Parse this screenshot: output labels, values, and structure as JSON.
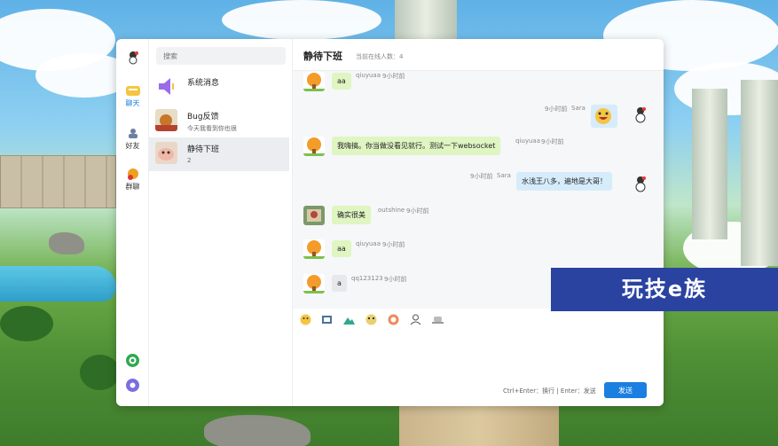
{
  "nav": {
    "items": [
      {
        "label": "聊天",
        "icon": "chat-icon"
      },
      {
        "label": "好友",
        "icon": "friends-icon"
      },
      {
        "label": "群聊",
        "icon": "group-icon"
      }
    ],
    "bottom_icons": [
      "help-icon",
      "settings-icon"
    ]
  },
  "search": {
    "placeholder": "搜索"
  },
  "conversations": [
    {
      "name": "系统消息",
      "preview": ""
    },
    {
      "name": "Bug反馈",
      "preview": "今天我看到你也很"
    },
    {
      "name": "静待下班",
      "preview": "2"
    }
  ],
  "chat": {
    "title": "静待下班",
    "online": "当前在线人数：4"
  },
  "messages": [
    {
      "side": "left",
      "text": "aa",
      "user": "qiuyuaa",
      "time": "9小时前"
    },
    {
      "side": "right",
      "text": "",
      "user": "Sara",
      "time": "9小时前",
      "sticker": "laughing-emoji"
    },
    {
      "side": "left",
      "text": "我嗨搞。你当做没看见就行。测试一下websocket",
      "user": "qiuyuaa",
      "time": "9小时前"
    },
    {
      "side": "right",
      "text": "水浅王八多，遍地是大哥！",
      "user": "Sara",
      "time": "9小时前"
    },
    {
      "side": "left",
      "text": "确实很美",
      "user": "outshine",
      "time": "9小时前"
    },
    {
      "side": "left",
      "text": "aa",
      "user": "qiuyuaa",
      "time": "9小时前"
    },
    {
      "side": "left",
      "text": "a",
      "user": "qq123123",
      "time": "9小时前"
    }
  ],
  "composer": {
    "hint": "Ctrl+Enter：换行 | Enter：发送",
    "send_label": "发送",
    "tools": [
      "emoji-icon",
      "image-icon",
      "mountain-icon",
      "face-icon",
      "sticker-icon",
      "user-icon",
      "hat-icon"
    ]
  },
  "watermark": "玩技e族",
  "colors": {
    "accent": "#1a7fe0",
    "bubble_left": "#dff5c2",
    "bubble_right": "#d6ecfb"
  }
}
